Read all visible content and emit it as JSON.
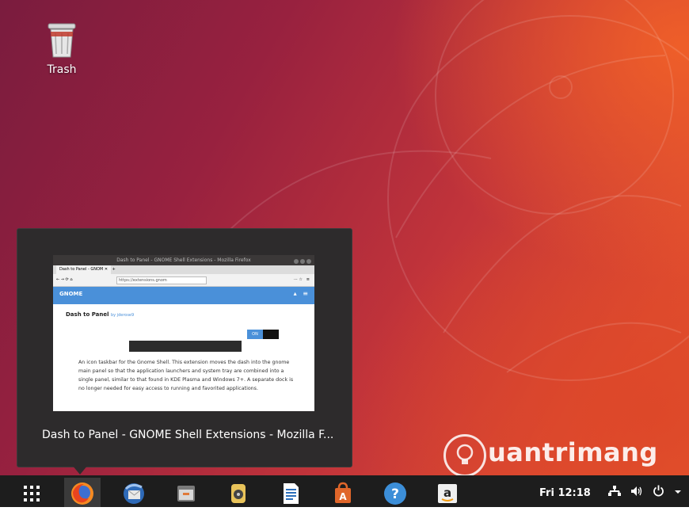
{
  "desktop": {
    "trash_label": "Trash"
  },
  "preview": {
    "window_title": "Dash to Panel - GNOME Shell Extensions - Mozilla F...",
    "thumbnail": {
      "titlebar": "Dash to Panel - GNOME Shell Extensions - Mozilla Firefox",
      "tab_label": "Dash to Panel - GNOM",
      "url": "https://extensions.gnom",
      "site_logo": "GNOME",
      "ext_name": "Dash to Panel",
      "ext_by": "by jderose9",
      "toggle_label": "ON",
      "description": "An icon taskbar for the Gnome Shell. This extension moves the dash into the gnome main panel so that the application launchers and system tray are combined into a single panel, similar to that found in KDE Plasma and Windows 7+. A separate dock is no longer needed for easy access to running and favorited applications."
    }
  },
  "watermark": {
    "text": "uantrimang"
  },
  "taskbar": {
    "items": [
      {
        "name": "show-applications",
        "icon": "grid-icon"
      },
      {
        "name": "firefox",
        "icon": "firefox-icon",
        "active": true
      },
      {
        "name": "thunderbird",
        "icon": "thunderbird-icon"
      },
      {
        "name": "files",
        "icon": "files-icon"
      },
      {
        "name": "rhythmbox",
        "icon": "rhythmbox-icon"
      },
      {
        "name": "libreoffice-writer",
        "icon": "writer-icon"
      },
      {
        "name": "ubuntu-software",
        "icon": "software-icon"
      },
      {
        "name": "help",
        "icon": "help-icon"
      },
      {
        "name": "amazon",
        "icon": "amazon-icon"
      }
    ],
    "clock": "Fri 12:18",
    "tray": [
      "network-icon",
      "volume-icon",
      "power-icon",
      "caret-down-icon"
    ]
  },
  "colors": {
    "taskbar_bg": "#1d1d1d",
    "popup_bg": "#2d2b2c",
    "gnome_blue": "#4a90d9"
  }
}
